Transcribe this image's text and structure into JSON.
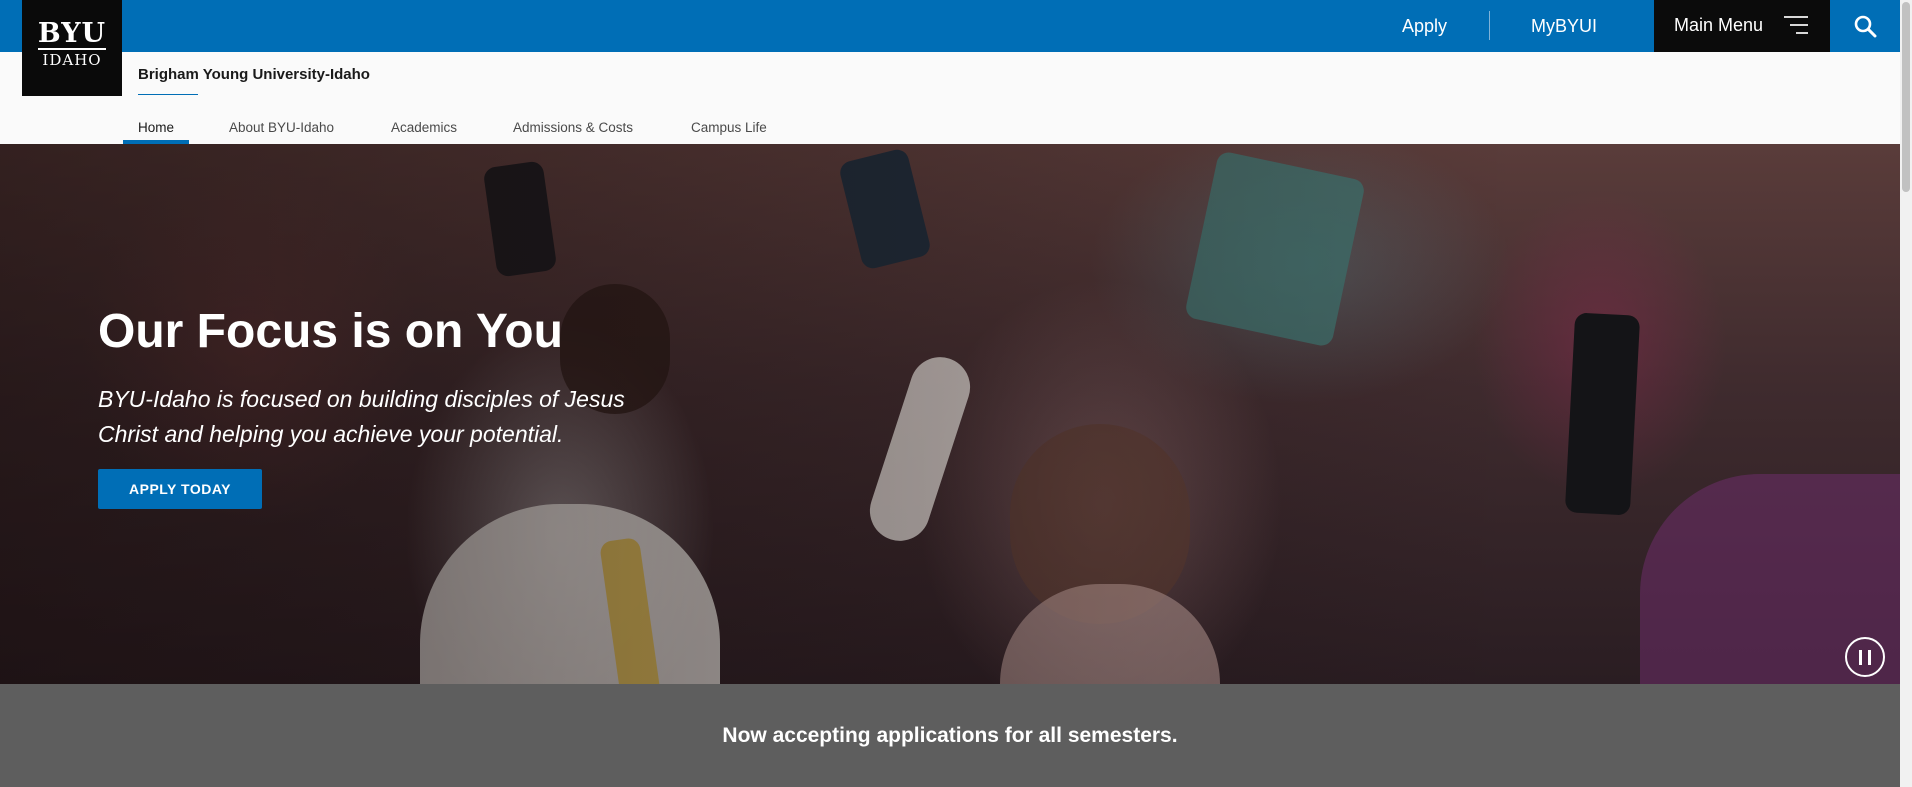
{
  "topbar": {
    "apply_label": "Apply",
    "mybyui_label": "MyBYUI",
    "main_menu_label": "Main Menu",
    "icons": {
      "menu": "hamburger-icon",
      "search": "search-icon"
    }
  },
  "logo": {
    "line1": "BYU",
    "line2": "IDAHO"
  },
  "site": {
    "title": "Brigham Young University-Idaho"
  },
  "nav": {
    "items": [
      {
        "label": "Home",
        "active": true
      },
      {
        "label": "About BYU-Idaho"
      },
      {
        "label": "Academics"
      },
      {
        "label": "Admissions & Costs"
      },
      {
        "label": "Campus Life"
      }
    ]
  },
  "hero": {
    "title": "Our Focus is on You",
    "subtitle": "BYU-Idaho is focused on building disciples of Jesus Christ and helping you achieve your potential.",
    "cta_label": "APPLY TODAY",
    "pause_icon": "pause-icon"
  },
  "banner": {
    "text": "Now accepting applications for all semesters."
  },
  "colors": {
    "brand_blue": "#006eb6",
    "black": "#0b0b0b",
    "banner_gray": "#5e5e5e"
  }
}
